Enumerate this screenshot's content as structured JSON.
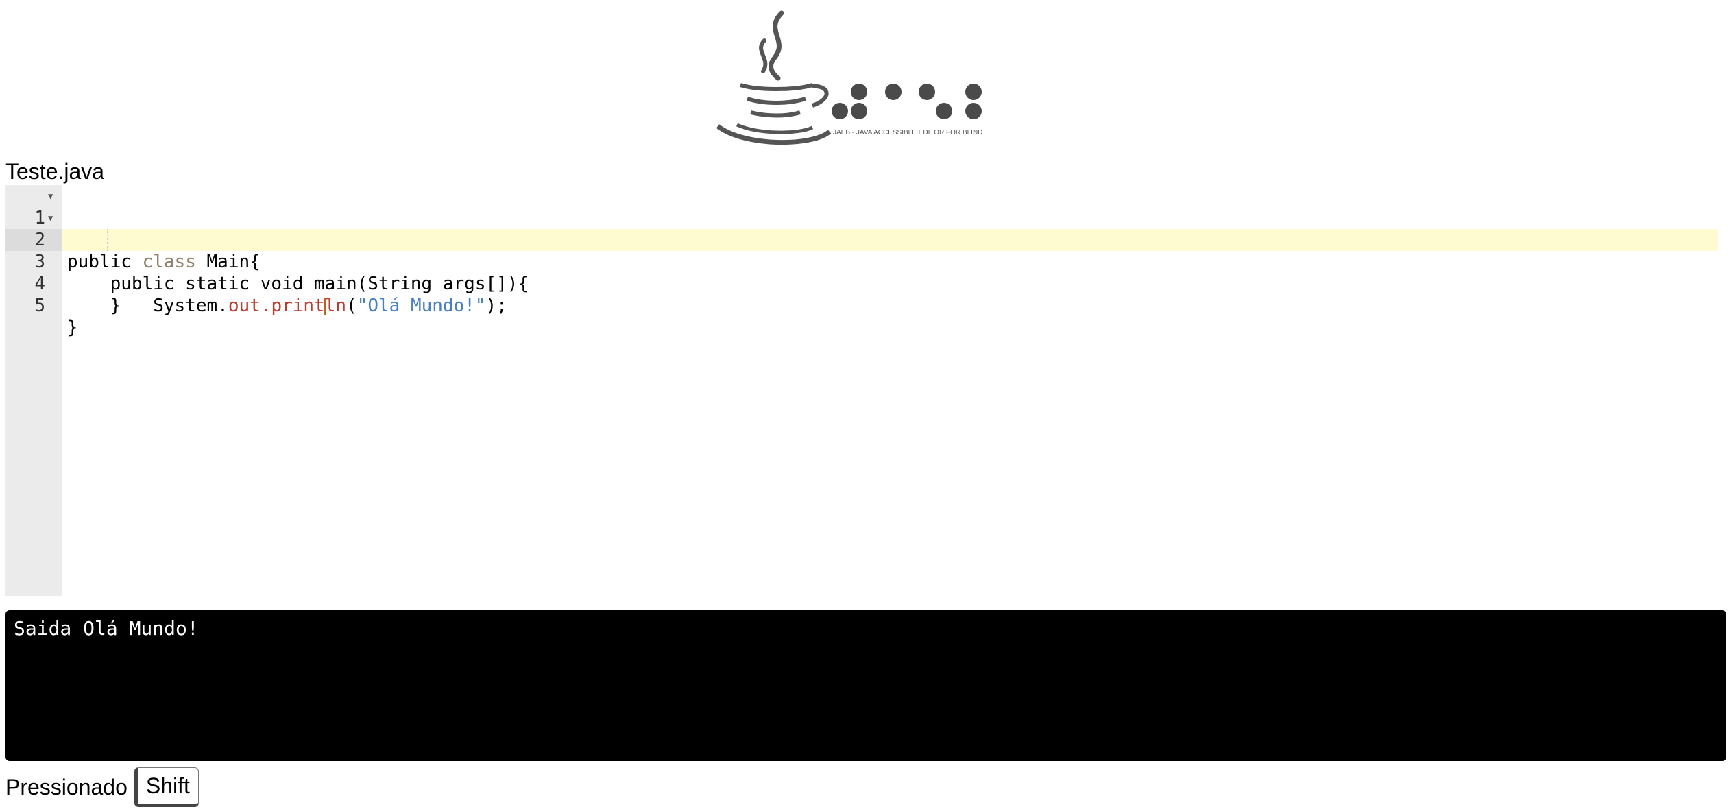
{
  "logo": {
    "caption": "JAEB - JAVA ACCESSIBLE EDITOR FOR BLIND"
  },
  "editor": {
    "filename": "Teste.java",
    "lines": [
      {
        "number": "1",
        "foldable": true
      },
      {
        "number": "2",
        "foldable": true
      },
      {
        "number": "3",
        "foldable": false,
        "active": true
      },
      {
        "number": "4",
        "foldable": false
      },
      {
        "number": "5",
        "foldable": false
      }
    ],
    "code": {
      "l1_a": "public ",
      "l1_kw": "class",
      "l1_b": " Main{",
      "l2": "    public static void main(String args[]){",
      "l3_a": "        System.",
      "l3_out": "out",
      "l3_dot": ".",
      "l3_fn1": "print",
      "l3_fn2": "ln",
      "l3_paren": "(",
      "l3_str": "\"Olá Mundo!\"",
      "l3_end": ");",
      "l4": "    }",
      "l5": "}"
    },
    "colors": {
      "keyword": "#93806a",
      "method": "#c0392b",
      "string": "#4a7fc1",
      "active_line": "#fffbd1",
      "gutter": "#ebebeb"
    }
  },
  "console": {
    "output": "Saida Olá Mundo!"
  },
  "status": {
    "label": "Pressionado",
    "key": "Shift"
  }
}
